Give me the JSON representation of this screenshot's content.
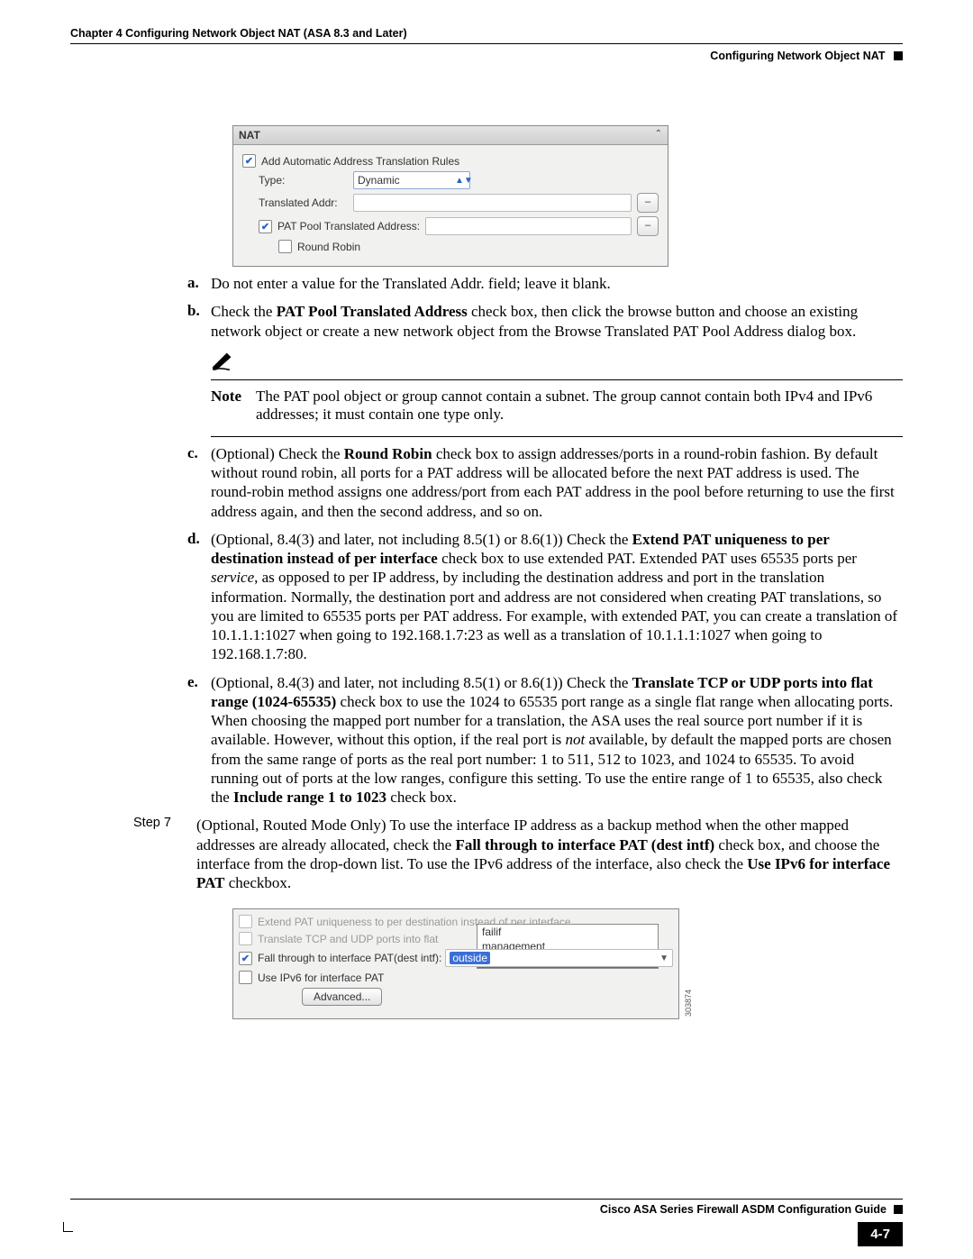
{
  "header": {
    "chapter_line": "Chapter 4    Configuring Network Object NAT (ASA 8.3 and Later)",
    "section_line": "Configuring Network Object NAT"
  },
  "shot1": {
    "panel_title": "NAT",
    "add_auto": "Add Automatic Address Translation Rules",
    "type_label": "Type:",
    "type_value": "Dynamic",
    "trans_addr_label": "Translated Addr:",
    "pat_pool_label": "PAT Pool Translated Address:",
    "round_robin": "Round Robin"
  },
  "items": {
    "a": "Do not enter a value for the Translated Addr. field; leave it blank.",
    "b_pre": "Check the ",
    "b_bold": "PAT Pool Translated Address",
    "b_post": " check box, then click the browse button and choose an existing network object or create a new network object from the Browse Translated PAT Pool Address dialog box.",
    "note_label": "Note",
    "note_text": "The PAT pool object or group cannot contain a subnet. The group cannot contain both IPv4 and IPv6 addresses; it must contain one type only.",
    "c_pre": "(Optional) Check the ",
    "c_bold": "Round Robin",
    "c_post": " check box to assign addresses/ports in a round-robin fashion. By default without round robin, all ports for a PAT address will be allocated before the next PAT address is used. The round-robin method assigns one address/port from each PAT address in the pool before returning to use the first address again, and then the second address, and so on.",
    "d_pre": "(Optional, 8.4(3) and later, not including 8.5(1) or 8.6(1)) Check the ",
    "d_bold": "Extend PAT uniqueness to per destination instead of per interface",
    "d_post1": " check box to use extended PAT. Extended PAT uses 65535 ports per ",
    "d_ital": "service",
    "d_post2": ", as opposed to per IP address, by including the destination address and port in the translation information. Normally, the destination port and address are not considered when creating PAT translations, so you are limited to 65535 ports per PAT address. For example, with extended PAT, you can create a translation of 10.1.1.1:1027 when going to 192.168.1.7:23 as well as a translation of 10.1.1.1:1027 when going to 192.168.1.7:80.",
    "e_pre": "(Optional, 8.4(3) and later, not including 8.5(1) or 8.6(1)) Check the ",
    "e_bold": "Translate TCP or UDP ports into flat range (1024-65535)",
    "e_post1": " check box to use the 1024 to 65535 port range as a single flat range when allocating ports. When choosing the mapped port number for a translation, the ASA uses the real source port number if it is available. However, without this option, if the real port is ",
    "e_ital": "not",
    "e_post2": " available, by default the mapped ports are chosen from the same range of ports as the real port number: 1 to 511, 512 to 1023, and 1024 to 65535. To avoid running out of ports at the low ranges, configure this setting. To use the entire range of 1 to 65535, also check the ",
    "e_bold2": "Include range 1 to 1023",
    "e_post3": " check box."
  },
  "step7": {
    "label": "Step 7",
    "pre": "(Optional, Routed Mode Only) To use the interface IP address as a backup method when the other mapped addresses are already allocated, check the ",
    "bold1": "Fall through to interface PAT (dest intf)",
    "mid": " check box, and choose the interface from the drop-down list. To use the IPv6 address of the interface, also check the ",
    "bold2": "Use IPv6 for interface PAT",
    "post": " checkbox."
  },
  "shot2": {
    "extend_pat": "Extend PAT uniqueness to per destination instead of per interface",
    "translate_tcp": "Translate TCP and UDP ports into flat ",
    "fall_through": "Fall through to interface PAT(dest intf):",
    "use_ipv6": "Use IPv6 for interface PAT",
    "advanced": "Advanced...",
    "opt_failif": "failif",
    "opt_mgmt": "management",
    "opt_outside": "outside",
    "selected": "outside",
    "sidelabel": "303874"
  },
  "footer": {
    "guide": "Cisco ASA Series Firewall ASDM Configuration Guide",
    "pagenum": "4-7"
  }
}
